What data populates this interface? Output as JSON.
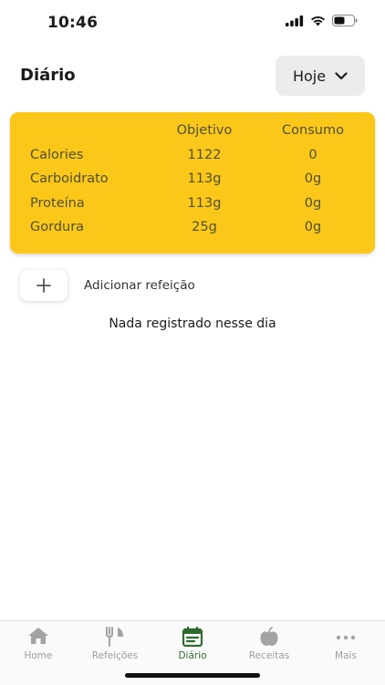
{
  "status_bar": {
    "time": "10:46"
  },
  "header": {
    "title": "Diário",
    "date_button": "Hoje"
  },
  "summary": {
    "headers": {
      "goal": "Objetivo",
      "consumed": "Consumo"
    },
    "rows": [
      {
        "label": "Calories",
        "goal": "1122",
        "consumed": "0"
      },
      {
        "label": "Carboidrato",
        "goal": "113g",
        "consumed": "0g"
      },
      {
        "label": "Proteína",
        "goal": "113g",
        "consumed": "0g"
      },
      {
        "label": "Gordura",
        "goal": "25g",
        "consumed": "0g"
      }
    ]
  },
  "add_meal": {
    "label": "Adicionar refeição"
  },
  "empty_message": "Nada registrado nesse dia",
  "tabs": [
    {
      "label": "Home",
      "icon": "home-icon",
      "active": false
    },
    {
      "label": "Refeições",
      "icon": "fork-knife-icon",
      "active": false
    },
    {
      "label": "Diário",
      "icon": "diary-icon",
      "active": true
    },
    {
      "label": "Receitas",
      "icon": "apple-icon",
      "active": false
    },
    {
      "label": "Mais",
      "icon": "more-icon",
      "active": false
    }
  ],
  "colors": {
    "card": "#fbc819",
    "active_tab": "#2f6b2f",
    "inactive_tab": "#9c9c9c"
  }
}
